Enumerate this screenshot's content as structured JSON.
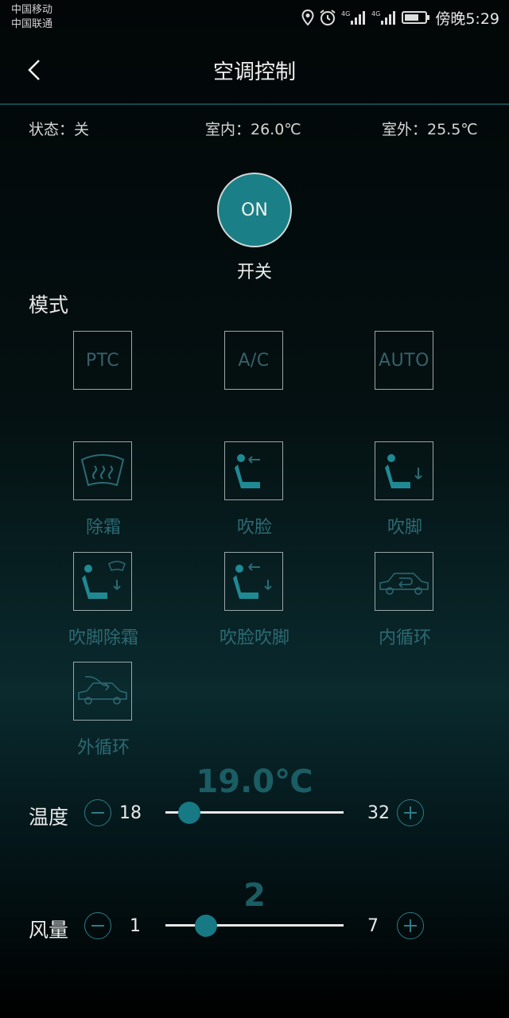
{
  "status_bar": {
    "carrier1": "中国移动",
    "carrier2": "中国联通",
    "time": "傍晚5:29"
  },
  "header": {
    "title": "空调控制"
  },
  "info": {
    "state": "状态：关",
    "indoor": "室内：26.0℃",
    "outdoor": "室外：25.5℃"
  },
  "power": {
    "button": "ON",
    "label": "开关"
  },
  "mode": {
    "title": "模式",
    "buttons": [
      "PTC",
      "A/C",
      "AUTO"
    ],
    "options": [
      {
        "label": "除霜",
        "icon": "defrost-icon"
      },
      {
        "label": "吹脸",
        "icon": "blow-face-icon"
      },
      {
        "label": "吹脚",
        "icon": "blow-feet-icon"
      },
      {
        "label": "吹脚除霜",
        "icon": "feet-defrost-icon"
      },
      {
        "label": "吹脸吹脚",
        "icon": "face-feet-icon"
      },
      {
        "label": "内循环",
        "icon": "recirculation-icon"
      },
      {
        "label": "外循环",
        "icon": "fresh-air-icon"
      }
    ]
  },
  "temperature": {
    "label": "温度",
    "value_text": "19.0℃",
    "min": "18",
    "max": "32",
    "value": 19,
    "range": [
      18,
      32
    ]
  },
  "fan": {
    "label": "风量",
    "value_text": "2",
    "min": "1",
    "max": "7",
    "value": 2,
    "range": [
      1,
      7
    ]
  },
  "colors": {
    "accent": "#167983",
    "icon": "#2c6a74",
    "box_border": "#9aa7a8"
  }
}
